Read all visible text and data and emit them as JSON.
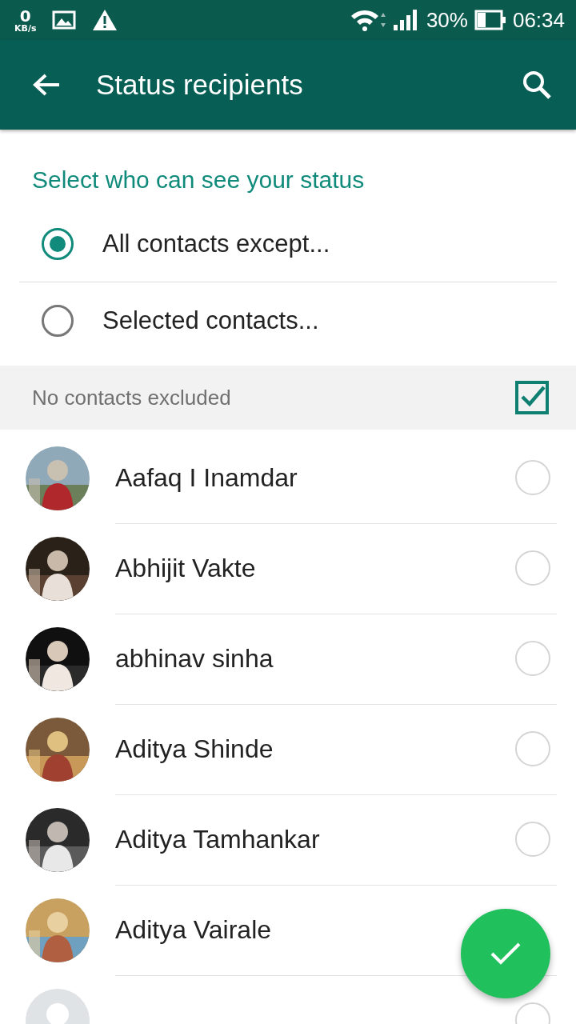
{
  "status_bar": {
    "speed_value": "0",
    "speed_unit": "KB/s",
    "battery": "30%",
    "time": "06:34"
  },
  "app_bar": {
    "title": "Status recipients"
  },
  "section_title": "Select who can see your status",
  "options": [
    {
      "label": "All contacts except...",
      "selected": true
    },
    {
      "label": "Selected contacts...",
      "selected": false
    }
  ],
  "summary": {
    "text": "No contacts excluded",
    "checked": true
  },
  "contacts": [
    {
      "name": "Aafaq I Inamdar",
      "selected": false
    },
    {
      "name": "Abhijit Vakte",
      "selected": false
    },
    {
      "name": "abhinav sinha",
      "selected": false
    },
    {
      "name": "Aditya Shinde",
      "selected": false
    },
    {
      "name": "Aditya Tamhankar",
      "selected": false
    },
    {
      "name": "Aditya Vairale"
    },
    {
      "kind": "default",
      "selected": false
    }
  ]
}
